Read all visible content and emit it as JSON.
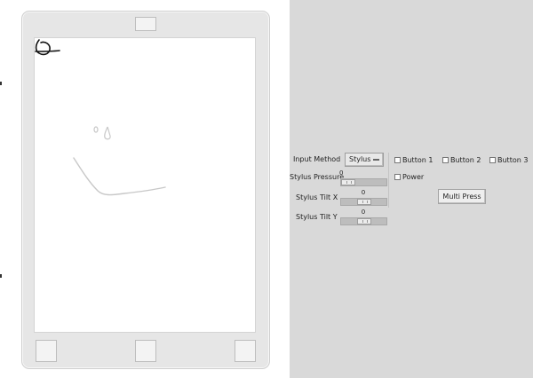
{
  "panel": {
    "input_method": {
      "label": "Input Method",
      "selected": "Stylus"
    },
    "stylus_pressure": {
      "label": "Stylus Pressure",
      "value": "0",
      "level": 0.0
    },
    "stylus_tilt_x": {
      "label": "Stylus Tilt X",
      "value": "0",
      "level": 0.5
    },
    "stylus_tilt_y": {
      "label": "Stylus Tilt Y",
      "value": "0",
      "level": 0.5
    },
    "checkboxes": [
      {
        "label": "Button 1",
        "checked": false
      },
      {
        "label": "Button 2",
        "checked": false
      },
      {
        "label": "Button 3",
        "checked": false
      },
      {
        "label": "Power",
        "checked": false
      }
    ],
    "multi_press_label": "Multi Press"
  },
  "colors": {
    "panel_bg": "#d9d9d9",
    "device_frame": "#e6e6e6",
    "ink_black": "#111111",
    "ink_gray": "#c8c8c8"
  }
}
